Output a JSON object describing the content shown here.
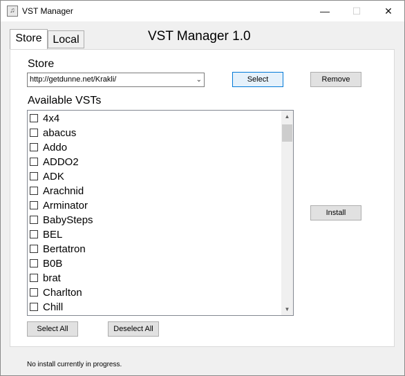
{
  "window": {
    "title": "VST Manager",
    "icon": "music-note-icon",
    "controls": {
      "minimize": "—",
      "maximize": "☐",
      "close": "✕"
    }
  },
  "tabs": [
    {
      "label": "Store",
      "active": true
    },
    {
      "label": "Local",
      "active": false
    }
  ],
  "header": {
    "title": "VST Manager 1.0"
  },
  "store": {
    "label": "Store",
    "selected_url": "http://getdunne.net/Krakli/",
    "select_label": "Select",
    "remove_label": "Remove"
  },
  "available": {
    "label": "Available VSTs",
    "items": [
      {
        "label": "4x4",
        "checked": false
      },
      {
        "label": "abacus",
        "checked": false
      },
      {
        "label": "Addo",
        "checked": false
      },
      {
        "label": "ADDO2",
        "checked": false
      },
      {
        "label": "ADK",
        "checked": false
      },
      {
        "label": "Arachnid",
        "checked": false
      },
      {
        "label": "Arminator",
        "checked": false
      },
      {
        "label": "BabySteps",
        "checked": false
      },
      {
        "label": "BEL",
        "checked": false
      },
      {
        "label": "Bertatron",
        "checked": false
      },
      {
        "label": "B0B",
        "checked": false
      },
      {
        "label": "brat",
        "checked": false
      },
      {
        "label": "Charlton",
        "checked": false
      },
      {
        "label": "Chill",
        "checked": false
      }
    ],
    "install_label": "Install",
    "select_all_label": "Select All",
    "deselect_all_label": "Deselect All"
  },
  "status": {
    "text": "No install currently in progress."
  },
  "colors": {
    "accent": "#0078d7",
    "panel_bg": "#ffffff",
    "window_bg": "#f0f0f0"
  }
}
